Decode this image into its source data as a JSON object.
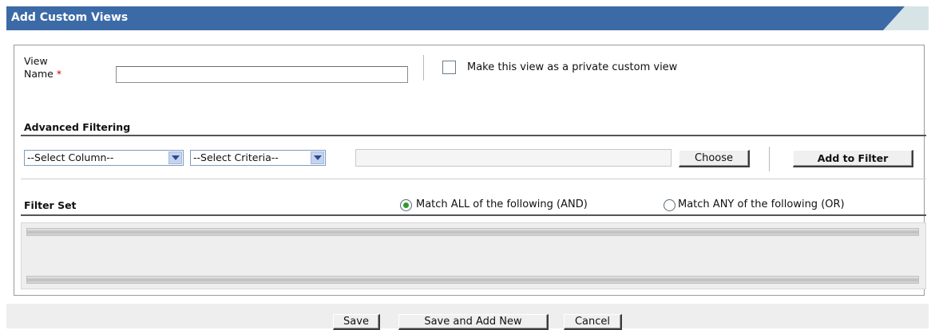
{
  "header": {
    "title": "Add Custom Views"
  },
  "form": {
    "view_name_label_line1": "View",
    "view_name_label_line2": "Name",
    "required_marker": "*",
    "view_name_value": "",
    "private_checkbox_checked": false,
    "private_label": "Make this view as a private custom view"
  },
  "advanced_filtering": {
    "title": "Advanced Filtering",
    "select_column": "--Select Column--",
    "select_criteria": "--Select Criteria--",
    "criteria_value": "",
    "choose_label": "Choose",
    "add_to_filter_label": "Add to Filter"
  },
  "filter_set": {
    "title": "Filter Set",
    "match_all_label": "Match ALL of the following (AND)",
    "match_any_label": "Match ANY of the following (OR)",
    "selected": "match_all"
  },
  "footer": {
    "save_label": "Save",
    "save_add_new_label": "Save and Add New",
    "cancel_label": "Cancel"
  },
  "colors": {
    "header_blue": "#3c6aa6",
    "header_corner": "#d6e4e6",
    "radio_selected": "#2c9a2c",
    "required": "#cc0000"
  }
}
